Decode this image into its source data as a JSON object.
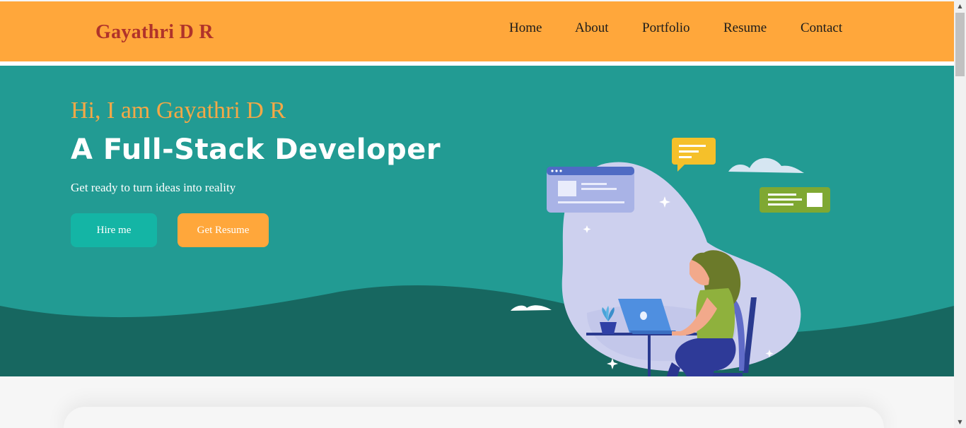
{
  "nav": {
    "brand": "Gayathri D R",
    "links": [
      "Home",
      "About",
      "Portfolio",
      "Resume",
      "Contact"
    ]
  },
  "hero": {
    "greeting": "Hi, I am Gayathri D R",
    "role": "A Full-Stack Developer",
    "tagline": "Get ready to turn ideas into reality",
    "hire_label": "Hire me",
    "resume_label": "Get Resume"
  },
  "colors": {
    "nav_bg": "#ffa73b",
    "brand": "#b0332a",
    "hero_bg": "#229b93",
    "wave": "#176760",
    "hire_btn": "#14b5a5",
    "resume_btn": "#ffa73b",
    "greeting": "#f5a846"
  },
  "icons": {
    "scroll_up": "triangle-up-icon",
    "scroll_down": "triangle-down-icon",
    "illustration": "developer-at-laptop-illustration"
  }
}
